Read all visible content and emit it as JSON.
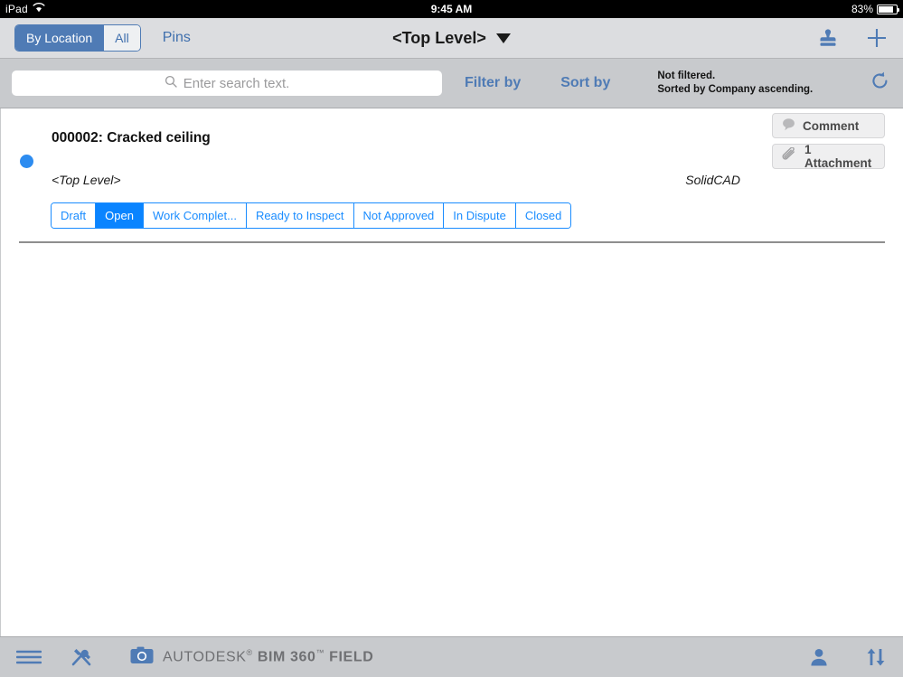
{
  "status_bar": {
    "device": "iPad",
    "wifi_icon": "wifi-icon",
    "time": "9:45 AM",
    "battery_percent": "83%",
    "battery_level": 83
  },
  "navbar": {
    "segments": [
      {
        "label": "By Location",
        "selected": true
      },
      {
        "label": "All",
        "selected": false
      }
    ],
    "pins_label": "Pins",
    "title": "<Top Level>",
    "dropdown_icon": "chevron-down-icon",
    "stamp_icon": "stamp-icon",
    "add_icon": "plus-icon"
  },
  "search_bar": {
    "search_icon": "search-icon",
    "placeholder": "Enter search text.",
    "value": "",
    "filter_by_label": "Filter by",
    "sort_by_label": "Sort by",
    "status_line_1": "Not filtered.",
    "status_line_2": "Sorted by Company ascending.",
    "refresh_icon": "refresh-icon"
  },
  "issue": {
    "marker_icon": "status-dot-icon",
    "marker_color": "#2d8cf0",
    "title": "000002: Cracked ceiling",
    "location": "<Top Level>",
    "company": "SolidCAD",
    "actions": [
      {
        "label": "Comment",
        "icon": "comment-icon"
      },
      {
        "label": "1 Attachment",
        "icon": "paperclip-icon"
      }
    ],
    "statuses": [
      {
        "label": "Draft",
        "selected": false
      },
      {
        "label": "Open",
        "selected": true
      },
      {
        "label": "Work Complet...",
        "selected": false
      },
      {
        "label": "Ready to Inspect",
        "selected": false
      },
      {
        "label": "Not Approved",
        "selected": false
      },
      {
        "label": "In Dispute",
        "selected": false
      },
      {
        "label": "Closed",
        "selected": false
      }
    ]
  },
  "bottom_bar": {
    "menu_icon": "hamburger-menu-icon",
    "tools_icon": "tools-icon",
    "camera_icon": "camera-icon",
    "brand_prefix": "AUTODESK",
    "brand_registered": "®",
    "brand_main": "BIM 360",
    "brand_tm": "™",
    "brand_suffix": "FIELD",
    "user_icon": "person-icon",
    "sync_icon": "sync-arrows-icon"
  },
  "colors": {
    "accent_blue": "#4f7bb5",
    "status_blue": "#0a84ff",
    "toolbar_gray": "#c8cacd",
    "navbar_gray": "#dcdde0"
  }
}
